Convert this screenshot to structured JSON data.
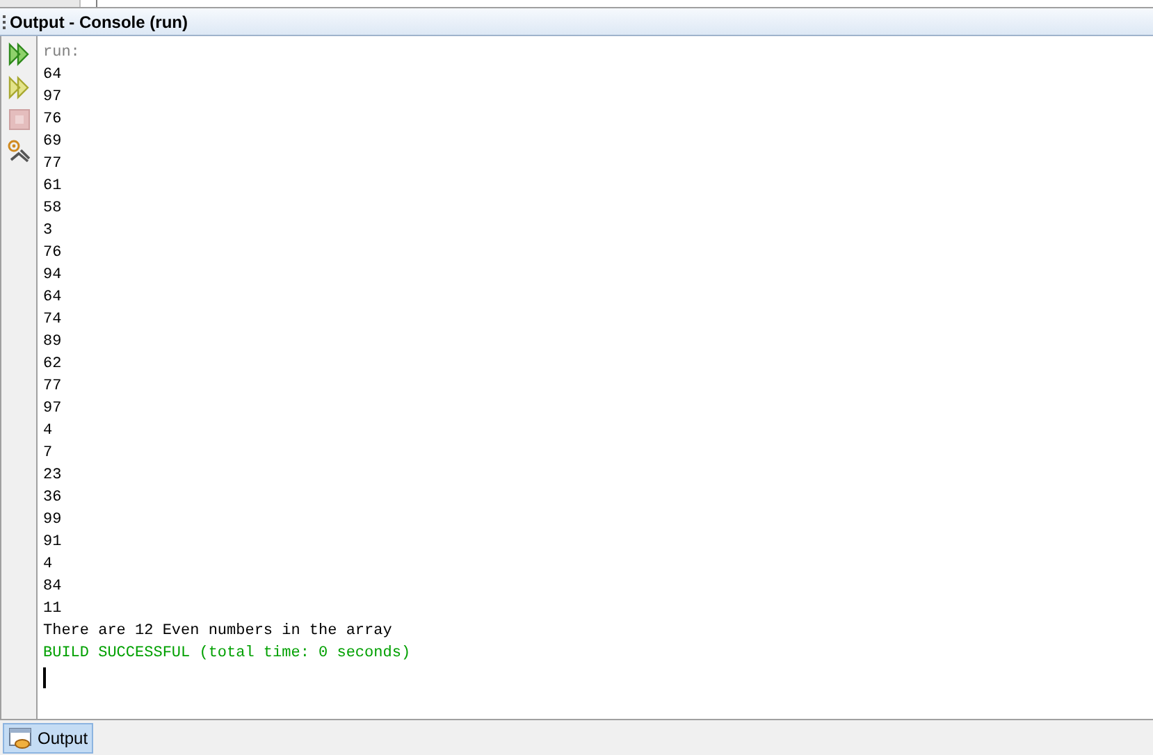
{
  "panel": {
    "title": "Output - Console (run)"
  },
  "toolbar": [
    {
      "kind": "rerun",
      "disabled": false
    },
    {
      "kind": "rerun-options",
      "disabled": false
    },
    {
      "kind": "stop",
      "disabled": true
    },
    {
      "kind": "settings",
      "disabled": false
    }
  ],
  "console_lines": [
    {
      "kind": "info",
      "text": "run:"
    },
    {
      "kind": "output",
      "text": "64"
    },
    {
      "kind": "output",
      "text": "97"
    },
    {
      "kind": "output",
      "text": "76"
    },
    {
      "kind": "output",
      "text": "69"
    },
    {
      "kind": "output",
      "text": "77"
    },
    {
      "kind": "output",
      "text": "61"
    },
    {
      "kind": "output",
      "text": "58"
    },
    {
      "kind": "output",
      "text": "3"
    },
    {
      "kind": "output",
      "text": "76"
    },
    {
      "kind": "output",
      "text": "94"
    },
    {
      "kind": "output",
      "text": "64"
    },
    {
      "kind": "output",
      "text": "74"
    },
    {
      "kind": "output",
      "text": "89"
    },
    {
      "kind": "output",
      "text": "62"
    },
    {
      "kind": "output",
      "text": "77"
    },
    {
      "kind": "output",
      "text": "97"
    },
    {
      "kind": "output",
      "text": "4"
    },
    {
      "kind": "output",
      "text": "7"
    },
    {
      "kind": "output",
      "text": "23"
    },
    {
      "kind": "output",
      "text": "36"
    },
    {
      "kind": "output",
      "text": "99"
    },
    {
      "kind": "output",
      "text": "91"
    },
    {
      "kind": "output",
      "text": "4"
    },
    {
      "kind": "output",
      "text": "84"
    },
    {
      "kind": "output",
      "text": "11"
    },
    {
      "kind": "output",
      "text": "There are 12 Even numbers in the array"
    },
    {
      "kind": "success",
      "text": "BUILD SUCCESSFUL (total time: 0 seconds)"
    }
  ],
  "bottom_tabs": [
    {
      "label": "Output",
      "selected": true
    }
  ]
}
